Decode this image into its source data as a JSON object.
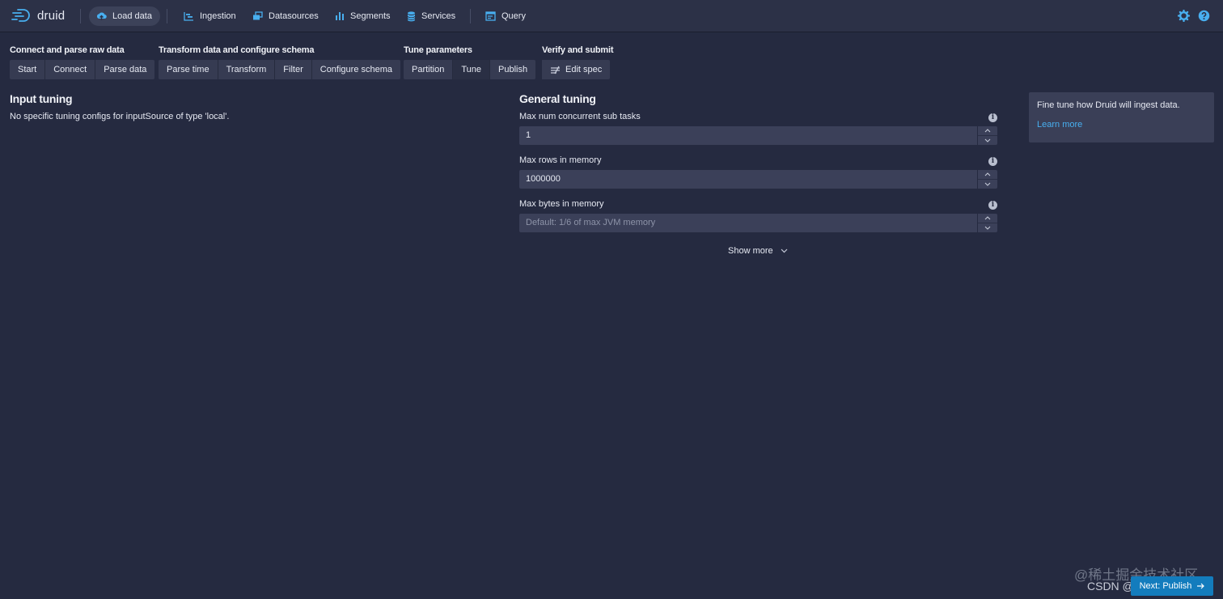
{
  "app": {
    "logo_text": "druid"
  },
  "nav": {
    "items": [
      {
        "label": "Load data",
        "icon": "cloud-upload-icon",
        "active": true
      },
      {
        "label": "Ingestion",
        "icon": "gantt-chart-icon"
      },
      {
        "label": "Datasources",
        "icon": "multi-select-icon"
      },
      {
        "label": "Segments",
        "icon": "stacked-chart-icon"
      },
      {
        "label": "Services",
        "icon": "database-icon"
      },
      {
        "label": "Query",
        "icon": "application-icon"
      }
    ],
    "settings_icon": "cog-icon",
    "help_icon": "help-icon"
  },
  "steps": [
    {
      "title": "Connect and parse raw data",
      "buttons": [
        "Start",
        "Connect",
        "Parse data"
      ]
    },
    {
      "title": "Transform data and configure schema",
      "buttons": [
        "Parse time",
        "Transform",
        "Filter",
        "Configure schema"
      ]
    },
    {
      "title": "Tune parameters",
      "buttons": [
        "Partition",
        "Tune",
        "Publish"
      ],
      "active": "Tune"
    },
    {
      "title": "Verify and submit",
      "buttons": [
        "Edit spec"
      ]
    }
  ],
  "input_tuning": {
    "title": "Input tuning",
    "text": "No specific tuning configs for inputSource of type 'local'."
  },
  "general_tuning": {
    "title": "General tuning",
    "fields": [
      {
        "label": "Max num concurrent sub tasks",
        "value": "1",
        "placeholder": ""
      },
      {
        "label": "Max rows in memory",
        "value": "1000000",
        "placeholder": ""
      },
      {
        "label": "Max bytes in memory",
        "value": "",
        "placeholder": "Default: 1/6 of max JVM memory"
      }
    ],
    "show_more": "Show more"
  },
  "callout": {
    "text": "Fine tune how Druid will ingest data.",
    "link": "Learn more"
  },
  "footer": {
    "watermark": "@稀土掘金技术社区",
    "csdn": "CSDN @",
    "next_button": "Next: Publish"
  },
  "colors": {
    "background": "#252a40",
    "nav_background": "#2c3147",
    "input_background": "#3b4059",
    "link": "#48aff0",
    "primary_button": "#137cbd",
    "accent_icon": "#48aff0"
  }
}
